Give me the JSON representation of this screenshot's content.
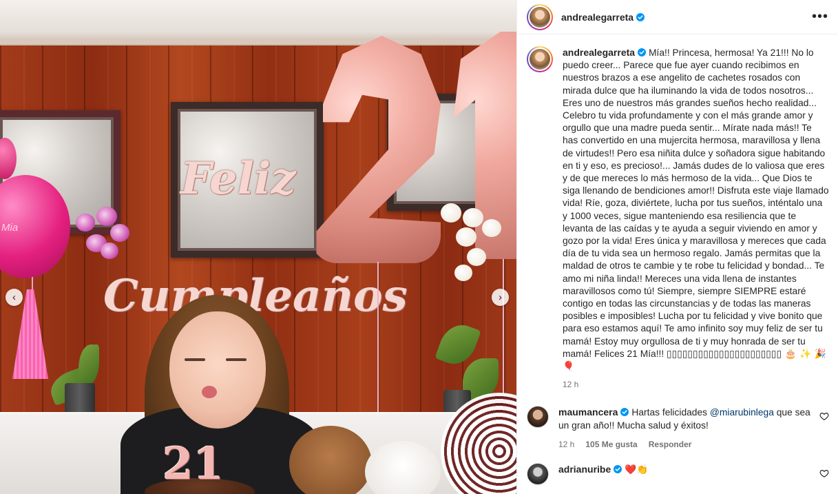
{
  "post": {
    "username": "andrealegarreta",
    "more_icon": "more-horizontal-icon",
    "verified_color": "#0095f6",
    "caption": {
      "username": "andrealegarreta",
      "text": "Mía!! Princesa, hermosa! Ya 21!!! No lo puedo creer... Parece que fue ayer cuando recibimos en nuestros brazos a ese angelito de cachetes rosados con mirada dulce que ha iluminando la vida de todos nosotros... Eres uno de nuestros más grandes sueños hecho realidad... Celebro tu vida profundamente y con el más grande amor y orgullo que una madre pueda sentir... Mírate nada más!! Te has convertido en una mujercita hermosa, maravillosa y llena de virtudes!! Pero esa niñita dulce y soñadora sigue habitando en ti y eso, es precioso!... Jamás dudes de lo valiosa que eres y de que mereces lo más hermoso de la vida... Que Dios te siga llenando de bendiciones amor!! Disfruta este viaje llamado vida! Ríe, goza, diviértete, lucha por tus sueños, inténtalo una y 1000 veces, sigue manteniendo esa resiliencia que te levanta de las caídas y te ayuda a seguir viviendo en amor y gozo por la vida! Eres única y maravillosa y mereces que cada día de tu vida sea un hermoso regalo. Jamás permitas que la maldad de otros te cambie y te robe tu felicidad y bondad... Te amo mi niña linda!! Mereces una vida llena de instantes maravillosos como tú! Siempre, siempre SIEMPRE estaré contigo en todas las circunstancias y de todas las maneras posibles e imposibles! Lucha por tu felicidad y vive bonito que para eso estamos aquí! Te amo infinito soy muy feliz de ser tu mamá! Estoy muy orgullosa de ti y muy honrada de ser tu mamá! Felices 21 Mía!!! ",
      "emoji_tail": "▯▯▯▯▯▯▯▯▯▯▯▯▯▯▯▯▯▯▯▯▯▯ 🎂 ✨ 🎉 🎈",
      "time": "12 h"
    },
    "comments": [
      {
        "username": "maumancera",
        "text_before": "Hartas felicidades ",
        "mention": "@miarubinlega",
        "text_after": " que sea un gran año!! Mucha salud y éxitos!",
        "time": "12 h",
        "likes": "105 Me gusta",
        "reply": "Responder"
      },
      {
        "username": "adrianuribe",
        "emojis": "❤️👏"
      }
    ]
  },
  "photo": {
    "balloon_word_1": "Feliz",
    "balloon_word_2": "Cumpleaños",
    "balloon_number": "21",
    "pink_balloon_text": "Mia",
    "cake_topper": "21"
  },
  "nav": {
    "prev_icon": "chevron-left-icon",
    "next_icon": "chevron-right-icon"
  }
}
